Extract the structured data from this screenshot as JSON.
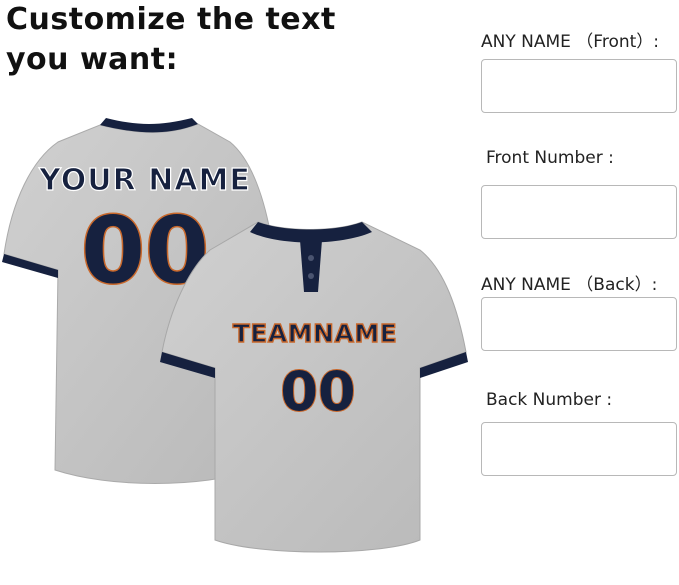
{
  "headline": "Customize the text\nyou want:",
  "back_jersey": {
    "name": "YOUR NAME",
    "number": "00"
  },
  "front_jersey": {
    "team": "TEAMNAME",
    "number": "00"
  },
  "fields": [
    {
      "label": "ANY NAME （Front）:",
      "value": ""
    },
    {
      "label": "Front Number :",
      "value": ""
    },
    {
      "label": "ANY NAME （Back）:",
      "value": ""
    },
    {
      "label": "Back Number :",
      "value": ""
    }
  ],
  "colors": {
    "jersey_gray": "#c6c6c6",
    "trim_navy": "#16213f",
    "lettering_orange": "#c9682b",
    "lettering_white": "#ffffff"
  }
}
